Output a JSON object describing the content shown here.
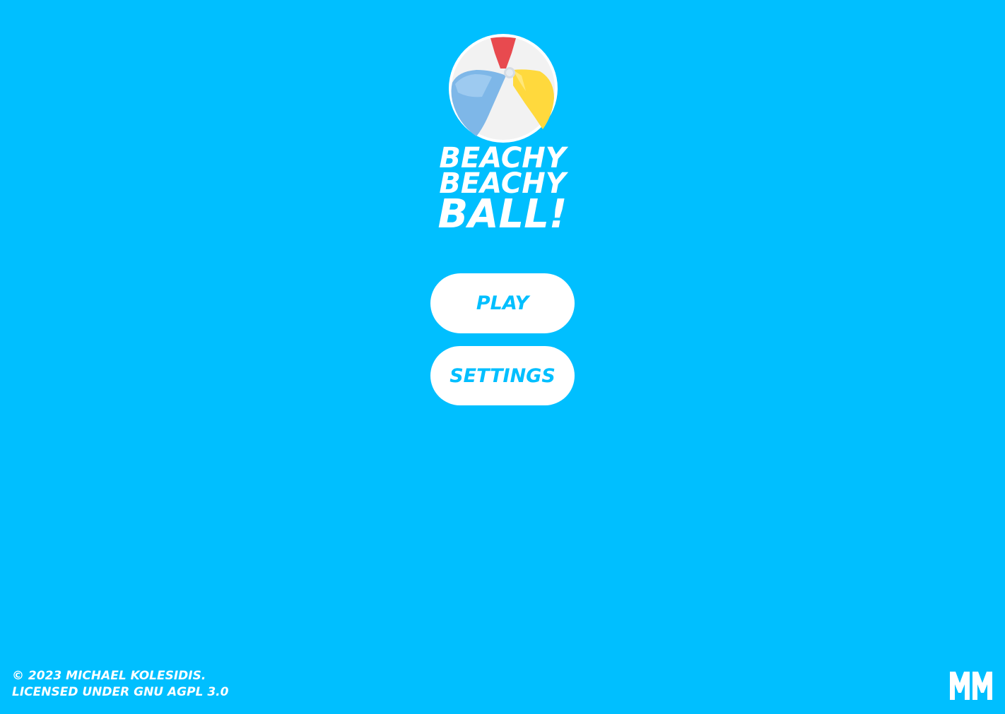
{
  "game": {
    "title_line_1": "BEACHY",
    "title_line_2": "BEACHY",
    "title_line_3": "BALL!",
    "logo_icon": "beach-ball-icon"
  },
  "menu": {
    "play_label": "PLAY",
    "settings_label": "SETTINGS"
  },
  "footer": {
    "copyright": "© 2023 MICHAEL KOLESIDIS.",
    "license_prefix": "LICENSED UNDER ",
    "license_link": "GNU AGPL 3.0",
    "brand_icon": "mm-logo-icon"
  },
  "colors": {
    "background": "#00BFFF",
    "button_background": "#FFFFFF",
    "button_text": "#00BFFF",
    "ball_red": "#E84A4F",
    "ball_blue": "#7EB7E8",
    "ball_yellow": "#FFD93D",
    "ball_white": "#F2F2F2"
  }
}
